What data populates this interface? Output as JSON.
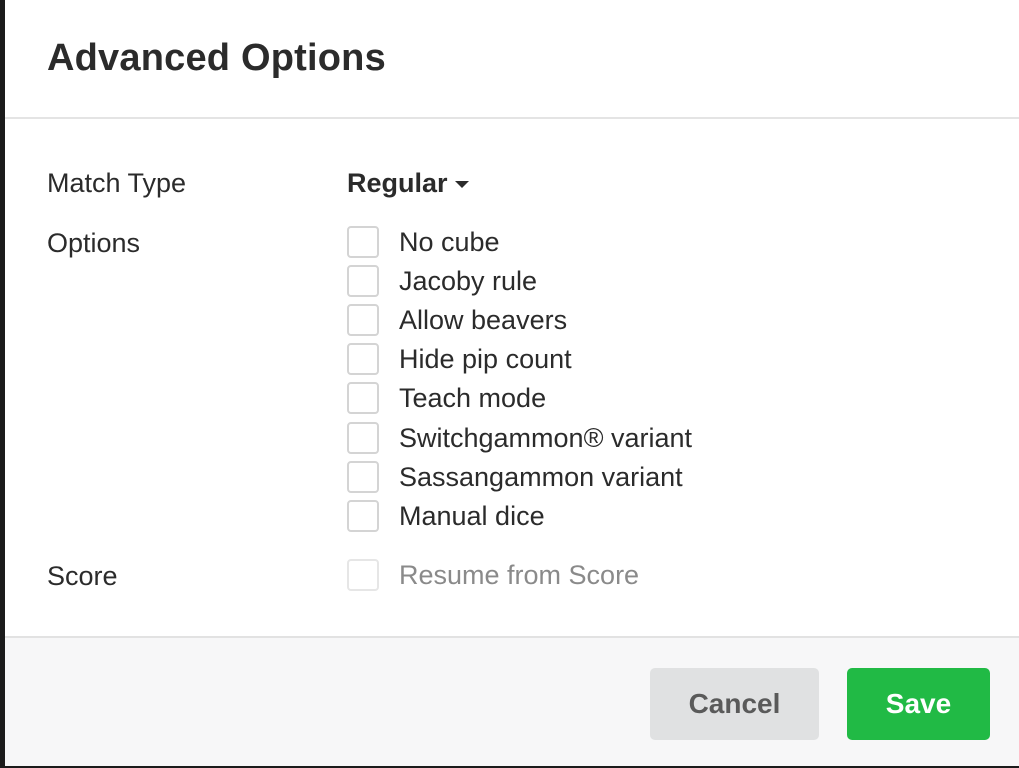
{
  "dialog": {
    "title": "Advanced Options"
  },
  "match_type": {
    "label": "Match Type",
    "value": "Regular"
  },
  "options": {
    "label": "Options",
    "items": [
      {
        "label": "No cube",
        "checked": false
      },
      {
        "label": "Jacoby rule",
        "checked": false
      },
      {
        "label": "Allow beavers",
        "checked": false
      },
      {
        "label": "Hide pip count",
        "checked": false
      },
      {
        "label": "Teach mode",
        "checked": false
      },
      {
        "label": "Switchgammon® variant",
        "checked": false
      },
      {
        "label": "Sassangammon variant",
        "checked": false
      },
      {
        "label": "Manual dice",
        "checked": false
      }
    ]
  },
  "score": {
    "label": "Score",
    "resume_label": "Resume from Score",
    "resume_checked": false,
    "resume_disabled": true
  },
  "footer": {
    "cancel_label": "Cancel",
    "save_label": "Save"
  },
  "colors": {
    "save_button": "#21ba45",
    "cancel_button": "#e0e1e2",
    "text": "#2b2b2b",
    "disabled_text": "#8a8a8a"
  }
}
